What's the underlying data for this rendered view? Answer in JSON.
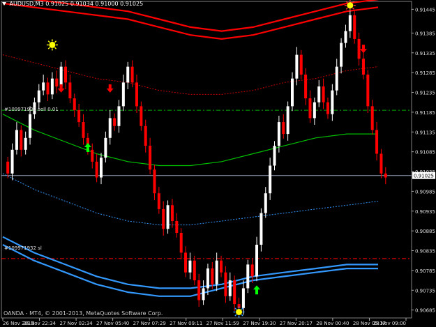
{
  "header": {
    "symbol_timeframe": "AUDUSD,M3",
    "ohlc": "0.91025 0.91034 0.91000 0.91025"
  },
  "orders": {
    "sell_label": "#109971932 sell 0.01",
    "stop_label": "#109971932 sl"
  },
  "copyright": "OANDA - MT4, © 2001-2013, MetaQuotes Software Corp.",
  "price_axis": {
    "ticks": [
      "0.91445",
      "0.91385",
      "0.91335",
      "0.91285",
      "0.91235",
      "0.91185",
      "0.91135",
      "0.91085",
      "0.91035",
      "0.90985",
      "0.90935",
      "0.90885",
      "0.90835",
      "0.90785",
      "0.90735",
      "0.90685"
    ],
    "current_price": "0.91025"
  },
  "time_axis": {
    "ticks": [
      "26 Nov 2013",
      "26 Nov 22:34",
      "27 Nov 02:34",
      "27 Nov 05:40",
      "27 Nov 07:29",
      "27 Nov 09:11",
      "27 Nov 11:59",
      "27 Nov 19:30",
      "27 Nov 20:17",
      "28 Nov 00:40",
      "28 Nov 05:17",
      "28 Nov 09:00"
    ]
  },
  "colors": {
    "background": "#000000",
    "bull_candle": "#ffffff",
    "bear_candle": "#ff0000",
    "upper_band": "#ff0000",
    "lower_band": "#3399ff",
    "middle_line": "#00c000",
    "sell_line": "#00aa00",
    "stop_line": "#ff0000",
    "arrow_up": "#00ff00",
    "arrow_down": "#ff0000",
    "sun_marker": "#ffff00"
  },
  "chart_data": {
    "type": "candlestick",
    "symbol": "AUDUSD",
    "timeframe": "M3",
    "ylim": [
      0.90665,
      0.91465
    ],
    "current_price": 0.91025,
    "sell_order_price": 0.9119,
    "stop_order_price": 0.90815,
    "closes": [
      0.9103,
      0.9109,
      0.9114,
      0.9109,
      0.9112,
      0.9118,
      0.9121,
      0.9124,
      0.9126,
      0.9123,
      0.9127,
      0.9125,
      0.913,
      0.9126,
      0.9122,
      0.9119,
      0.9116,
      0.9112,
      0.9109,
      0.9106,
      0.9102,
      0.9107,
      0.9112,
      0.9117,
      0.9115,
      0.912,
      0.9126,
      0.913,
      0.9126,
      0.912,
      0.9115,
      0.911,
      0.9104,
      0.9098,
      0.9094,
      0.9089,
      0.9095,
      0.9091,
      0.9088,
      0.9083,
      0.9078,
      0.9081,
      0.9076,
      0.9071,
      0.9074,
      0.9079,
      0.9075,
      0.9081,
      0.9078,
      0.9072,
      0.9076,
      0.907,
      0.9069,
      0.9074,
      0.908,
      0.9077,
      0.9085,
      0.9093,
      0.9098,
      0.9105,
      0.911,
      0.9116,
      0.9113,
      0.912,
      0.9127,
      0.9133,
      0.9128,
      0.9122,
      0.9117,
      0.9121,
      0.9125,
      0.9121,
      0.9118,
      0.9124,
      0.913,
      0.9136,
      0.9139,
      0.9143,
      0.9137,
      0.9132,
      0.9128,
      0.912,
      0.9114,
      0.9108,
      0.9103,
      0.9102
    ],
    "band_upper_outer": [
      0.9148,
      0.9147,
      0.9146,
      0.9145,
      0.9144,
      0.9142,
      0.914,
      0.9139,
      0.914,
      0.9142,
      0.9144,
      0.9146,
      0.9147
    ],
    "band_upper_inner": [
      0.9146,
      0.9145,
      0.9144,
      0.9143,
      0.9142,
      0.914,
      0.9138,
      0.9137,
      0.9138,
      0.914,
      0.9142,
      0.9144,
      0.9145
    ],
    "band_upper_dotted": [
      0.9133,
      0.9131,
      0.9129,
      0.9127,
      0.9126,
      0.9124,
      0.9123,
      0.9123,
      0.9124,
      0.9126,
      0.9127,
      0.9129,
      0.913
    ],
    "middle_line": [
      0.9118,
      0.9114,
      0.9111,
      0.9108,
      0.9106,
      0.9105,
      0.9105,
      0.9106,
      0.9108,
      0.911,
      0.9112,
      0.9113,
      0.9113
    ],
    "band_lower_dotted": [
      0.9103,
      0.9099,
      0.9096,
      0.9093,
      0.9091,
      0.909,
      0.909,
      0.9091,
      0.9092,
      0.9093,
      0.9094,
      0.9095,
      0.9096
    ],
    "band_lower_inner": [
      0.9087,
      0.9083,
      0.908,
      0.9077,
      0.9075,
      0.9074,
      0.9074,
      0.9075,
      0.9077,
      0.9078,
      0.9079,
      0.908,
      0.908
    ],
    "band_lower_outer": [
      0.9085,
      0.9081,
      0.9078,
      0.9075,
      0.9073,
      0.9072,
      0.9072,
      0.9074,
      0.9076,
      0.9077,
      0.9078,
      0.9079,
      0.9079
    ]
  }
}
